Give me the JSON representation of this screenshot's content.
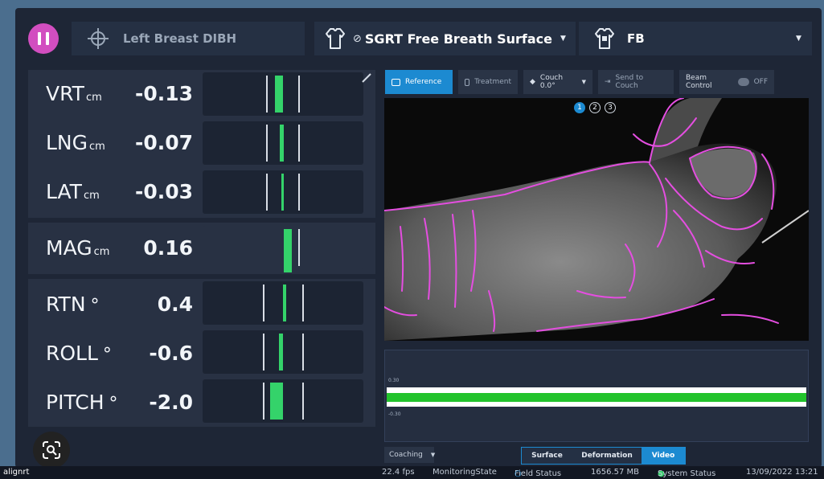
{
  "header": {
    "pause_icon": "pause-icon",
    "plan_icon": "crosshair-icon",
    "plan_label": "Left Breast DIBH",
    "surface_icon": "torso-icon",
    "surface_ban_icon": "ban-icon",
    "surface_label": "SGRT Free Breath Surface",
    "fb_icon": "torso-icon",
    "fb_label": "FB"
  },
  "translations": [
    {
      "name": "VRT",
      "unit": "cm",
      "value": "-0.13"
    },
    {
      "name": "LNG",
      "unit": "cm",
      "value": "-0.07"
    },
    {
      "name": "LAT",
      "unit": "cm",
      "value": "-0.03"
    }
  ],
  "magnitude": {
    "name": "MAG",
    "unit": "cm",
    "value": "0.16"
  },
  "rotations": [
    {
      "name": "RTN",
      "unit": "°",
      "value": "0.4"
    },
    {
      "name": "ROLL",
      "unit": "°",
      "value": "-0.6"
    },
    {
      "name": "PITCH",
      "unit": "°",
      "value": "-2.0"
    }
  ],
  "toolbar": {
    "reference": "Reference",
    "treatment": "Treatment",
    "couch": "Couch 0.0°",
    "send_to_couch": "Send to Couch",
    "beam_control": "Beam Control",
    "beam_state": "OFF"
  },
  "video": {
    "pages": [
      "1",
      "2",
      "3"
    ],
    "active_page": "1"
  },
  "graph": {
    "upper_label": "0.30",
    "lower_label": "-0.30"
  },
  "coaching": {
    "label": "Coaching"
  },
  "view_tabs": [
    "Surface",
    "Deformation",
    "Video"
  ],
  "active_view_tab": "Video",
  "statusbar": {
    "brand": "alignrt",
    "fps": "22.4 fps",
    "state": "MonitoringState",
    "field_status": "Field Status",
    "memory": "1656.57 MB",
    "system_status": "System Status",
    "datetime": "13/09/2022 13:21"
  },
  "colors": {
    "accent": "#1c8ad1",
    "ok_green": "#34d36a",
    "pause": "#d24ec0",
    "outline": "#e44ee0"
  }
}
